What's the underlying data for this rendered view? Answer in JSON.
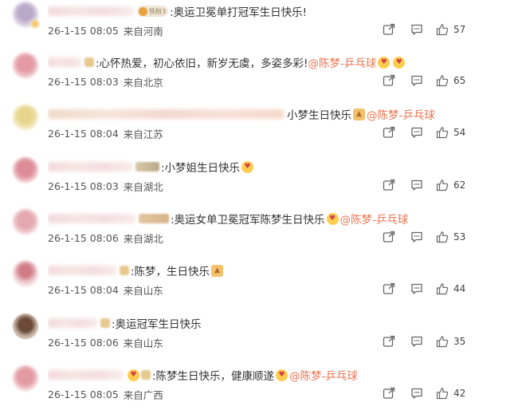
{
  "comments": [
    {
      "text": ":奥运卫冕单打冠军生日快乐!",
      "badge": "铁粉3",
      "time": "26-1-15 08:05",
      "location": "来自河南",
      "likes": "57"
    },
    {
      "text": ":心怀热爱，初心依旧，新岁无虞，多姿多彩! ",
      "mention": "@陈梦-乒乓球",
      "time": "26-1-15 08:03",
      "location": "来自北京",
      "likes": "65"
    },
    {
      "text": "小梦生日快乐",
      "mention": "@陈梦-乒乓球",
      "time": "26-1-15 08:04",
      "location": "来自江苏",
      "likes": "54"
    },
    {
      "text": ":小梦姐生日快乐",
      "time": "26-1-15 08:03",
      "location": "来自湖北",
      "likes": "62"
    },
    {
      "text": ":奥运女单卫冕冠军陈梦生日快乐",
      "mention": "@陈梦-乒乓球",
      "time": "26-1-15 08:06",
      "location": "来自湖北",
      "likes": "53"
    },
    {
      "text": ":陈梦，生日快乐",
      "time": "26-1-15 08:04",
      "location": "来自山东",
      "likes": "44"
    },
    {
      "text": ":奥运冠军生日快乐",
      "time": "26-1-15 08:06",
      "location": "来自山东",
      "likes": "35"
    },
    {
      "text": ":陈梦生日快乐，健康顺遂",
      "mention": "@陈梦-乒乓球",
      "time": "26-1-15 08:05",
      "location": "来自广西",
      "likes": "42"
    }
  ],
  "colors": {
    "mention": "#eb7350",
    "text": "#333333",
    "meta": "#555555",
    "icon": "#666666"
  },
  "icons": {
    "share": "share-icon",
    "reply": "comment-icon",
    "like": "thumbs-up-icon"
  }
}
